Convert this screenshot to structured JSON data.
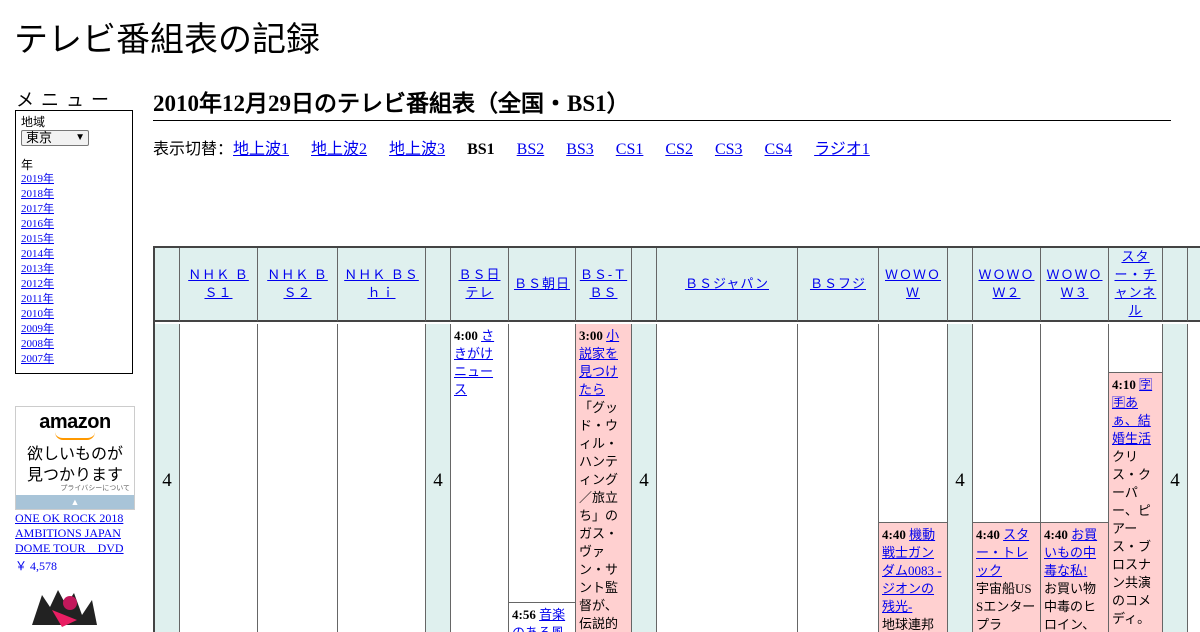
{
  "site_title": "テレビ番組表の記録",
  "menu": {
    "heading": "メニュー",
    "region_label": "地域",
    "region_value": "東京",
    "year_label": "年",
    "years": [
      "2019年",
      "2018年",
      "2017年",
      "2016年",
      "2015年",
      "2014年",
      "2013年",
      "2012年",
      "2011年",
      "2010年",
      "2009年",
      "2008年",
      "2007年"
    ]
  },
  "ad": {
    "logo": "amazon",
    "copy_line1": "欲しいものが",
    "copy_line2": "見つかります",
    "privacy": "プライバシーについて",
    "bar": "▲"
  },
  "product": {
    "title": "ONE OK ROCK 2018 AMBITIONS JAPAN DOME TOUR　DVD",
    "price": "￥ 4,578"
  },
  "page_title": "2010年12月29日のテレビ番組表（全国・BS1）",
  "switcher": {
    "label": "表示切替：",
    "items": [
      {
        "label": "地上波1",
        "current": false
      },
      {
        "label": "地上波2",
        "current": false
      },
      {
        "label": "地上波3",
        "current": false
      },
      {
        "label": "BS1",
        "current": true
      },
      {
        "label": "BS2",
        "current": false
      },
      {
        "label": "BS3",
        "current": false
      },
      {
        "label": "CS1",
        "current": false
      },
      {
        "label": "CS2",
        "current": false
      },
      {
        "label": "CS3",
        "current": false
      },
      {
        "label": "CS4",
        "current": false
      },
      {
        "label": "ラジオ1",
        "current": false
      }
    ]
  },
  "grid": {
    "hour": "4",
    "channels": [
      "ＮＨＫ ＢＳ１",
      "ＮＨＫ ＢＳ２",
      "ＮＨＫ ＢＳｈｉ",
      "ＢＳ日テレ",
      "ＢＳ朝日",
      "ＢＳ-ＴＢＳ",
      "ＢＳジャパン",
      "ＢＳフジ",
      "ＷＯＷＯＷ",
      "ＷＯＷＯＷ２",
      "ＷＯＷＯＷ３",
      "スター・チャンネル"
    ],
    "programs": {
      "bs_ntv": {
        "time": "4:00",
        "title": "さきがけニュース"
      },
      "bs_asahi": {
        "time": "4:56",
        "title": "音楽のある風"
      },
      "bs_tbs": {
        "time": "3:00",
        "title": "小説家を見つけたら",
        "desc": "「グッド・ウィル・ハンティング／旅立ち」のガス・ヴァン・サント監督が、伝説的"
      },
      "wowow": {
        "time": "4:40",
        "title": "機動戦士ガンダム0083 -ジオンの残光-",
        "desc": "地球連邦"
      },
      "wowow2": {
        "time": "4:40",
        "title": "スター・トレック",
        "desc": "宇宙船USSエンタープラ"
      },
      "wowow3": {
        "time": "4:40",
        "title": "お買いもの中毒な私!",
        "desc": "お買い物中毒のヒロイン、"
      },
      "star": {
        "time": "4:10",
        "title": "🈑🈐あぁ、結婚生活",
        "desc": "クリス・クーパー、ピアース・ブロスナン共演のコメディ。"
      }
    }
  }
}
